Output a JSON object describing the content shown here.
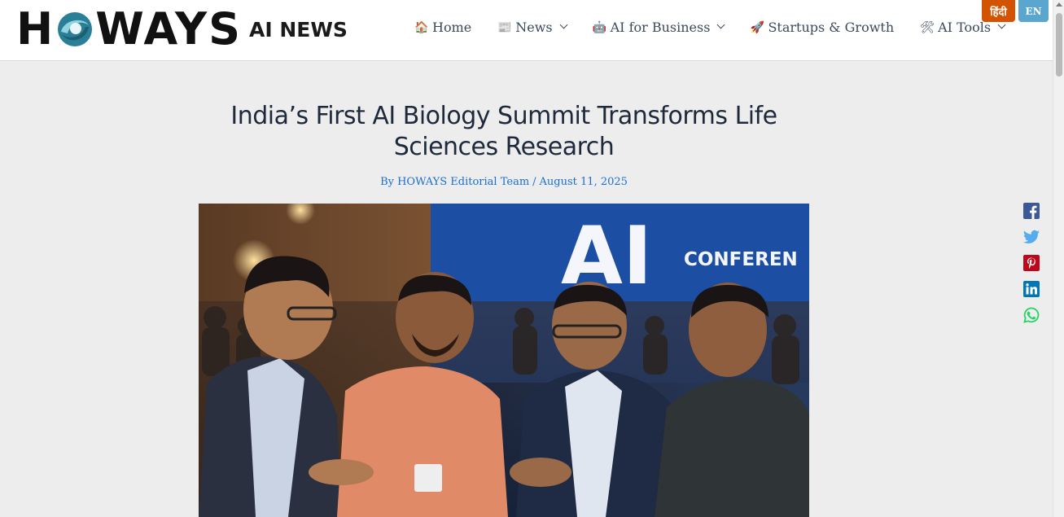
{
  "header": {
    "logo_text_left": "H",
    "logo_text_right": "WAYS",
    "logo_tagline": "AI NEWS",
    "nav": [
      {
        "label": "Home",
        "icon": "house-icon",
        "glyph": "🏠",
        "dropdown": false
      },
      {
        "label": "News",
        "icon": "newspaper-icon",
        "glyph": "📰",
        "dropdown": true
      },
      {
        "label": "AI for Business",
        "icon": "robot-icon",
        "glyph": "🤖",
        "dropdown": true
      },
      {
        "label": "Startups & Growth",
        "icon": "rocket-icon",
        "glyph": "🚀",
        "dropdown": false
      },
      {
        "label": "AI Tools",
        "icon": "tools-icon",
        "glyph": "🛠",
        "dropdown": true
      }
    ],
    "lang": {
      "hindi": "हिंदी",
      "english": "EN"
    }
  },
  "article": {
    "title": "India’s First AI Biology Summit Transforms Life Sciences Research",
    "author": "By HOWAYS Editorial Team",
    "date": "August 11, 2025",
    "hero_banner_text": "AI",
    "hero_banner_sub": "CONFEREN"
  },
  "share": [
    {
      "name": "facebook-icon",
      "color": "#3b5998"
    },
    {
      "name": "twitter-icon",
      "color": "#55acee"
    },
    {
      "name": "pinterest-icon",
      "color": "#bd081c"
    },
    {
      "name": "linkedin-icon",
      "color": "#0077b5"
    },
    {
      "name": "whatsapp-icon",
      "color": "#25d366"
    }
  ],
  "colors": {
    "accent_orange": "#d35400",
    "accent_blue": "#5aa6cf",
    "link_blue": "#1a6fd0"
  }
}
